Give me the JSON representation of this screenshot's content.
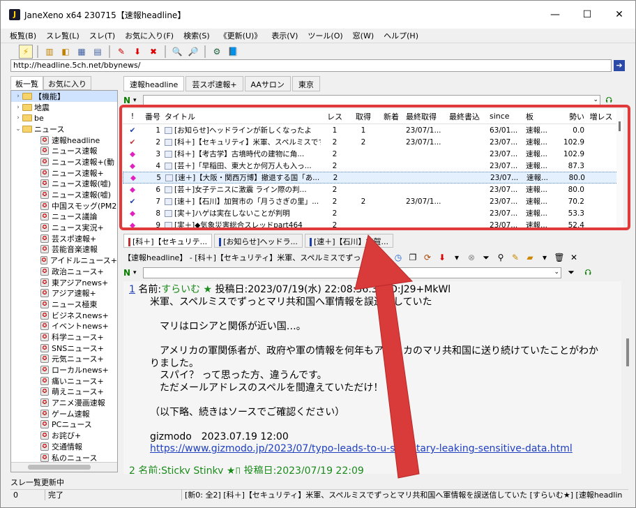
{
  "window": {
    "title": "JaneXeno x64 230715【速報headline】",
    "minimize": "—",
    "maximize": "☐",
    "close": "✕"
  },
  "menu": [
    "板覧(B)",
    "スレ覧(L)",
    "スレ(T)",
    "お気に入り(F)",
    "検索(S)",
    "《更新(U)》",
    "表示(V)",
    "ツール(O)",
    "窓(W)",
    "ヘルプ(H)"
  ],
  "address": "http://headline.5ch.net/bbynews/",
  "left_tabs": [
    "板一覧",
    "お気に入り"
  ],
  "tree": [
    {
      "type": "folder",
      "label": "【機能】",
      "exp": "›"
    },
    {
      "type": "folder",
      "label": "地震",
      "exp": "›"
    },
    {
      "type": "folder",
      "label": "be",
      "exp": "›"
    },
    {
      "type": "folder",
      "label": "ニュース",
      "exp": "⌄"
    },
    {
      "type": "board",
      "label": "速報headline"
    },
    {
      "type": "board",
      "label": "ニュース速報"
    },
    {
      "type": "board",
      "label": "ニュース速報+(動"
    },
    {
      "type": "board",
      "label": "ニュース速報+"
    },
    {
      "type": "board",
      "label": "ニュース速報(嘘)"
    },
    {
      "type": "board",
      "label": "ニュース速報(嘘)"
    },
    {
      "type": "board",
      "label": "中国スモッグ(PM2"
    },
    {
      "type": "board",
      "label": "ニュース議論"
    },
    {
      "type": "board",
      "label": "ニュース実況+"
    },
    {
      "type": "board",
      "label": "芸スポ速報+"
    },
    {
      "type": "board",
      "label": "芸能音楽速報"
    },
    {
      "type": "board",
      "label": "アイドルニュース+"
    },
    {
      "type": "board",
      "label": "政治ニュース+"
    },
    {
      "type": "board",
      "label": "東アジアnews+"
    },
    {
      "type": "board",
      "label": "アジア速報+"
    },
    {
      "type": "board",
      "label": "ニュース極東"
    },
    {
      "type": "board",
      "label": "ビジネスnews+"
    },
    {
      "type": "board",
      "label": "イベントnews+"
    },
    {
      "type": "board",
      "label": "科学ニュース+"
    },
    {
      "type": "board",
      "label": "SNSニュース+"
    },
    {
      "type": "board",
      "label": "元気ニュース+"
    },
    {
      "type": "board",
      "label": "ローカルnews+"
    },
    {
      "type": "board",
      "label": "痛いニュース+"
    },
    {
      "type": "board",
      "label": "萌えニュース+"
    },
    {
      "type": "board",
      "label": "アニメ漫画速報"
    },
    {
      "type": "board",
      "label": "ゲーム速報"
    },
    {
      "type": "board",
      "label": "PCニュース"
    },
    {
      "type": "board",
      "label": "お詫び+"
    },
    {
      "type": "board",
      "label": "交通情報"
    },
    {
      "type": "board",
      "label": "私のニュース"
    }
  ],
  "board_tabs": [
    "速報headline",
    "芸スポ速報+",
    "AAサロン",
    "東京"
  ],
  "columns": [
    "!",
    "番号",
    "タイトル",
    "レス",
    "取得",
    "新着",
    "最終取得",
    "最終書込",
    "since",
    "板",
    "勢い",
    "増レス"
  ],
  "threads": [
    {
      "mark": "✔",
      "mark_color": "#1a3fb0",
      "num": "1",
      "title": "[お知らせ]ヘッドラインが新しくなったよ",
      "res": "1",
      "get": "1",
      "new": "",
      "last": "23/07/1...",
      "lw": "",
      "since": "63/01...",
      "board": "速報...",
      "ikioi": "0.0",
      "inc": ""
    },
    {
      "mark": "✔",
      "mark_color": "#c03030",
      "num": "2",
      "title": "[科＋]【セキュリティ】米軍、スペルミスです...",
      "res": "2",
      "get": "2",
      "new": "",
      "last": "23/07/1...",
      "lw": "",
      "since": "23/07...",
      "board": "速報...",
      "ikioi": "102.9",
      "inc": ""
    },
    {
      "mark": "◆",
      "mark_color": "#e020c0",
      "num": "3",
      "title": "[科＋]【考古学】古墳時代の建物に角...",
      "res": "2",
      "get": "",
      "new": "",
      "last": "",
      "lw": "",
      "since": "23/07...",
      "board": "速報...",
      "ikioi": "102.9",
      "inc": ""
    },
    {
      "mark": "◆",
      "mark_color": "#e020c0",
      "num": "4",
      "title": "[芸＋]「早稲田、東大とか何万人も入っ...",
      "res": "2",
      "get": "",
      "new": "",
      "last": "",
      "lw": "",
      "since": "23/07...",
      "board": "速報...",
      "ikioi": "87.3",
      "inc": ""
    },
    {
      "mark": "◆",
      "mark_color": "#e020c0",
      "num": "5",
      "title": "[速＋]【大阪・関西万博】撤退する国「あ...",
      "res": "2",
      "get": "",
      "new": "",
      "last": "",
      "lw": "",
      "since": "23/07...",
      "board": "速報...",
      "ikioi": "80.0",
      "inc": "",
      "selected": true
    },
    {
      "mark": "◆",
      "mark_color": "#e020c0",
      "num": "6",
      "title": "[芸＋]女子テニスに激震 ライン際の判...",
      "res": "2",
      "get": "",
      "new": "",
      "last": "",
      "lw": "",
      "since": "23/07...",
      "board": "速報...",
      "ikioi": "80.0",
      "inc": ""
    },
    {
      "mark": "✔",
      "mark_color": "#1a3fb0",
      "num": "7",
      "title": "[速＋]【石川】加賀市の「月うさぎの里」...",
      "res": "2",
      "get": "2",
      "new": "",
      "last": "23/07/1...",
      "lw": "",
      "since": "23/07...",
      "board": "速報...",
      "ikioi": "70.2",
      "inc": ""
    },
    {
      "mark": "◆",
      "mark_color": "#e020c0",
      "num": "8",
      "title": "[実＋]ハゲは実在しないことが判明",
      "res": "2",
      "get": "",
      "new": "",
      "last": "",
      "lw": "",
      "since": "23/07...",
      "board": "速報...",
      "ikioi": "53.3",
      "inc": ""
    },
    {
      "mark": "◆",
      "mark_color": "#e020c0",
      "num": "9",
      "title": "[実＋]◆気象災害総合スレッドpart464",
      "res": "2",
      "get": "",
      "new": "",
      "last": "",
      "lw": "",
      "since": "23/07...",
      "board": "速報...",
      "ikioi": "52.4",
      "inc": ""
    }
  ],
  "thread_tabs": [
    {
      "label": "[科＋]【セキュリテ...",
      "color": "#c03030"
    },
    {
      "label": "[お知らせ]ヘッドラ...",
      "color": "#1a3fb0"
    },
    {
      "label": "[速＋]【石川】加賀...",
      "color": "#1a3fb0"
    }
  ],
  "thread_header": "【速報headline】 - [科＋]【セキュリティ】米軍、スペルミスでずっとマリ共和",
  "post1": {
    "num": "1",
    "name_label": "名前:",
    "name": "すらいむ",
    "star": "★",
    "date": "投稿日:2023/07/19(水) 22:08:36.30",
    "id": "ID:J29+MkWl",
    "lines": [
      "米軍、スペルミスでずっとマリ共和国へ軍情報を誤送信していた",
      "",
      "　マリはロシアと関係が近い国…。",
      "",
      "　アメリカの軍関係者が、政府や軍の情報を何年もアフリカのマリ共和国に送り続けていたことがわか",
      "りました。",
      "　スパイ？ って思った方、違うんです。",
      "　ただメールアドレスのスペルを間違えていただけ！",
      "",
      "（以下略、続きはソースでご確認ください）",
      "",
      "gizmodo　2023.07.19 12:00"
    ],
    "link": "https://www.gizmodo.jp/2023/07/typo-leads-to-u-s-military-leaking-sensitive-data.html"
  },
  "post2_partial": "2 名前:Sticky Stinky ★▯ 投稿日:2023/07/19 22:09",
  "status_line": "スレ一覧更新中",
  "statusbar": [
    "0",
    "完了",
    "[新0: 全2] [科＋]【セキュリティ】米軍、スペルミスでずっとマリ共和国へ軍情報を誤送信していた [すらいむ★] [速報headline/ニュース]"
  ]
}
